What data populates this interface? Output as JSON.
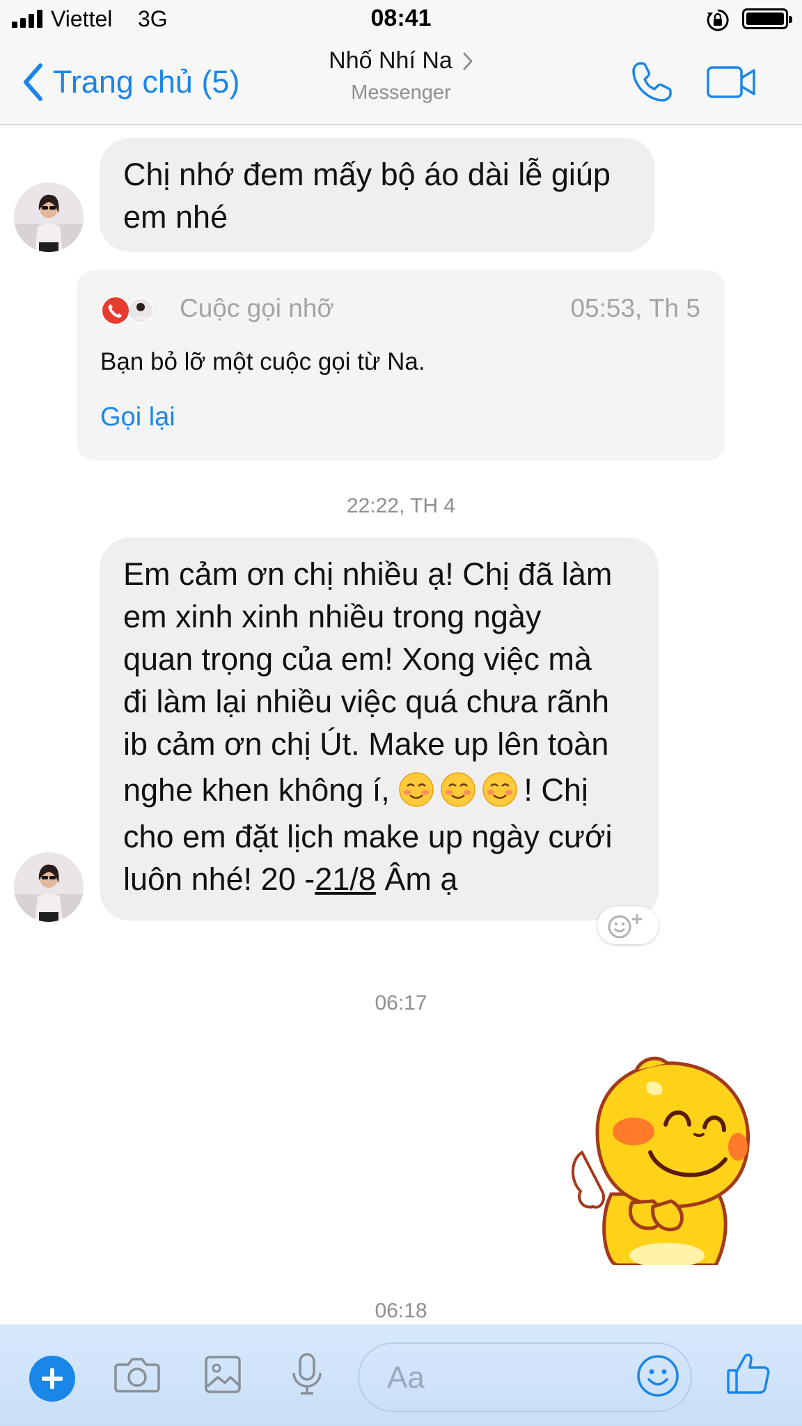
{
  "status_bar": {
    "carrier": "Viettel",
    "network": "3G",
    "time": "08:41"
  },
  "nav": {
    "back_label": "Trang chủ (5)",
    "title": "Nhố Nhí Na",
    "subtitle": "Messenger",
    "accent_color": "#1a86e8"
  },
  "messages": {
    "msg1": {
      "line1": "Chị nhớ đem mấy bộ áo dài lễ giúp",
      "line2": "em nhé"
    },
    "missed_call": {
      "title": "Cuộc gọi nhỡ",
      "time": "05:53, Th 5",
      "description": "Bạn bỏ lỡ một cuộc gọi từ Na.",
      "action": "Gọi lại"
    },
    "timestamp1": "22:22, TH 4",
    "msg2": {
      "line1": "Em cảm ơn chị nhiều ạ! Chị đã làm",
      "line2": "em xinh xinh nhiều trong ngày",
      "line3": "quan trọng của em! Xong việc mà",
      "line4": "đi làm lại nhiều việc quá chưa rãnh",
      "line5": "ib cảm ơn chị Út. Make up lên toàn",
      "line6_before": "nghe khen không í, ",
      "line6_after": "! Chị",
      "line7": "cho em đặt lịch make up ngày cưới",
      "line8_before": "luôn nhé! 20 -",
      "line8_date": "21/8",
      "line8_after": " Âm ạ",
      "emoji_icon": "smiling-face-emoji"
    },
    "timestamp2": "06:17",
    "sticker_icon": "yellow-dinosaur-sticker",
    "timestamp3": "06:18"
  },
  "composer": {
    "placeholder": "Aa",
    "icons": [
      "plus-icon",
      "camera-icon",
      "image-icon",
      "microphone-icon",
      "emoji-icon",
      "thumbs-up-icon"
    ]
  }
}
